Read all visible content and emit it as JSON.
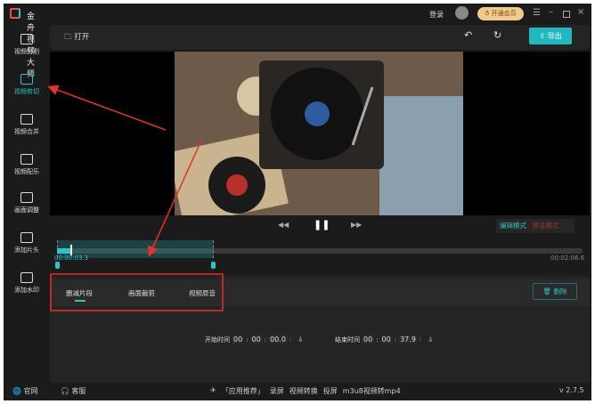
{
  "app": {
    "title": "金舟视频大师",
    "login": "登录",
    "vip": "开通会员",
    "version": "v 2.7.5"
  },
  "toolbar": {
    "open": "打开",
    "export": "导出"
  },
  "sidebar": {
    "items": [
      {
        "label": "视频分割"
      },
      {
        "label": "视频剪切"
      },
      {
        "label": "视频合并"
      },
      {
        "label": "视频配乐"
      },
      {
        "label": "画面调整"
      },
      {
        "label": "添加片头"
      },
      {
        "label": "添加水印"
      }
    ]
  },
  "player": {
    "edit_mode": "编辑模式",
    "preview_mode": "预览模式",
    "current_time": "00:00:03.3",
    "total_time": "00:02:06.6",
    "progress": 0.026,
    "selection_end": 0.3
  },
  "tabs": [
    {
      "label": "删减片段"
    },
    {
      "label": "画面裁剪"
    },
    {
      "label": "视频原音"
    }
  ],
  "delete": "删除",
  "time": {
    "start_label": "开始时间",
    "start": [
      "00",
      "00",
      "00.0"
    ],
    "end_label": "结束时间",
    "end": [
      "00",
      "00",
      "37.9"
    ]
  },
  "footer": {
    "website": "官网",
    "service": "客服",
    "recommend": "「应用推荐」",
    "links": [
      "录屏",
      "视频转换",
      "投屏",
      "m3u8视频转mp4"
    ]
  },
  "colors": {
    "accent": "#22b8bf",
    "annotation": "#e8302a"
  }
}
